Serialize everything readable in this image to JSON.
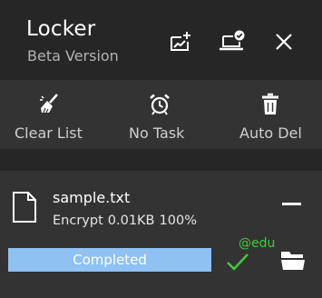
{
  "app": {
    "title": "Locker",
    "subtitle": "Beta Version"
  },
  "header": {
    "buttons": [
      {
        "name": "new-task-icon"
      },
      {
        "name": "laptop-check-icon"
      },
      {
        "name": "close-icon"
      }
    ]
  },
  "toolbar": {
    "items": [
      {
        "label": "Clear List",
        "icon": "broom-icon"
      },
      {
        "label": "No Task",
        "icon": "alarm-clock-icon"
      },
      {
        "label": "Auto Del",
        "icon": "trash-icon"
      }
    ]
  },
  "task": {
    "file_name": "sample.txt",
    "action": "Encrypt",
    "size": "0.01KB",
    "percent_text": "100%",
    "progress": 1.0,
    "status": "Completed"
  },
  "watermark": "@edu",
  "colors": {
    "background": "#262626",
    "panel": "#333333",
    "progress": "#8dbdf0",
    "check": "#3ccd3c",
    "subtitle": "#b3b3b3"
  }
}
